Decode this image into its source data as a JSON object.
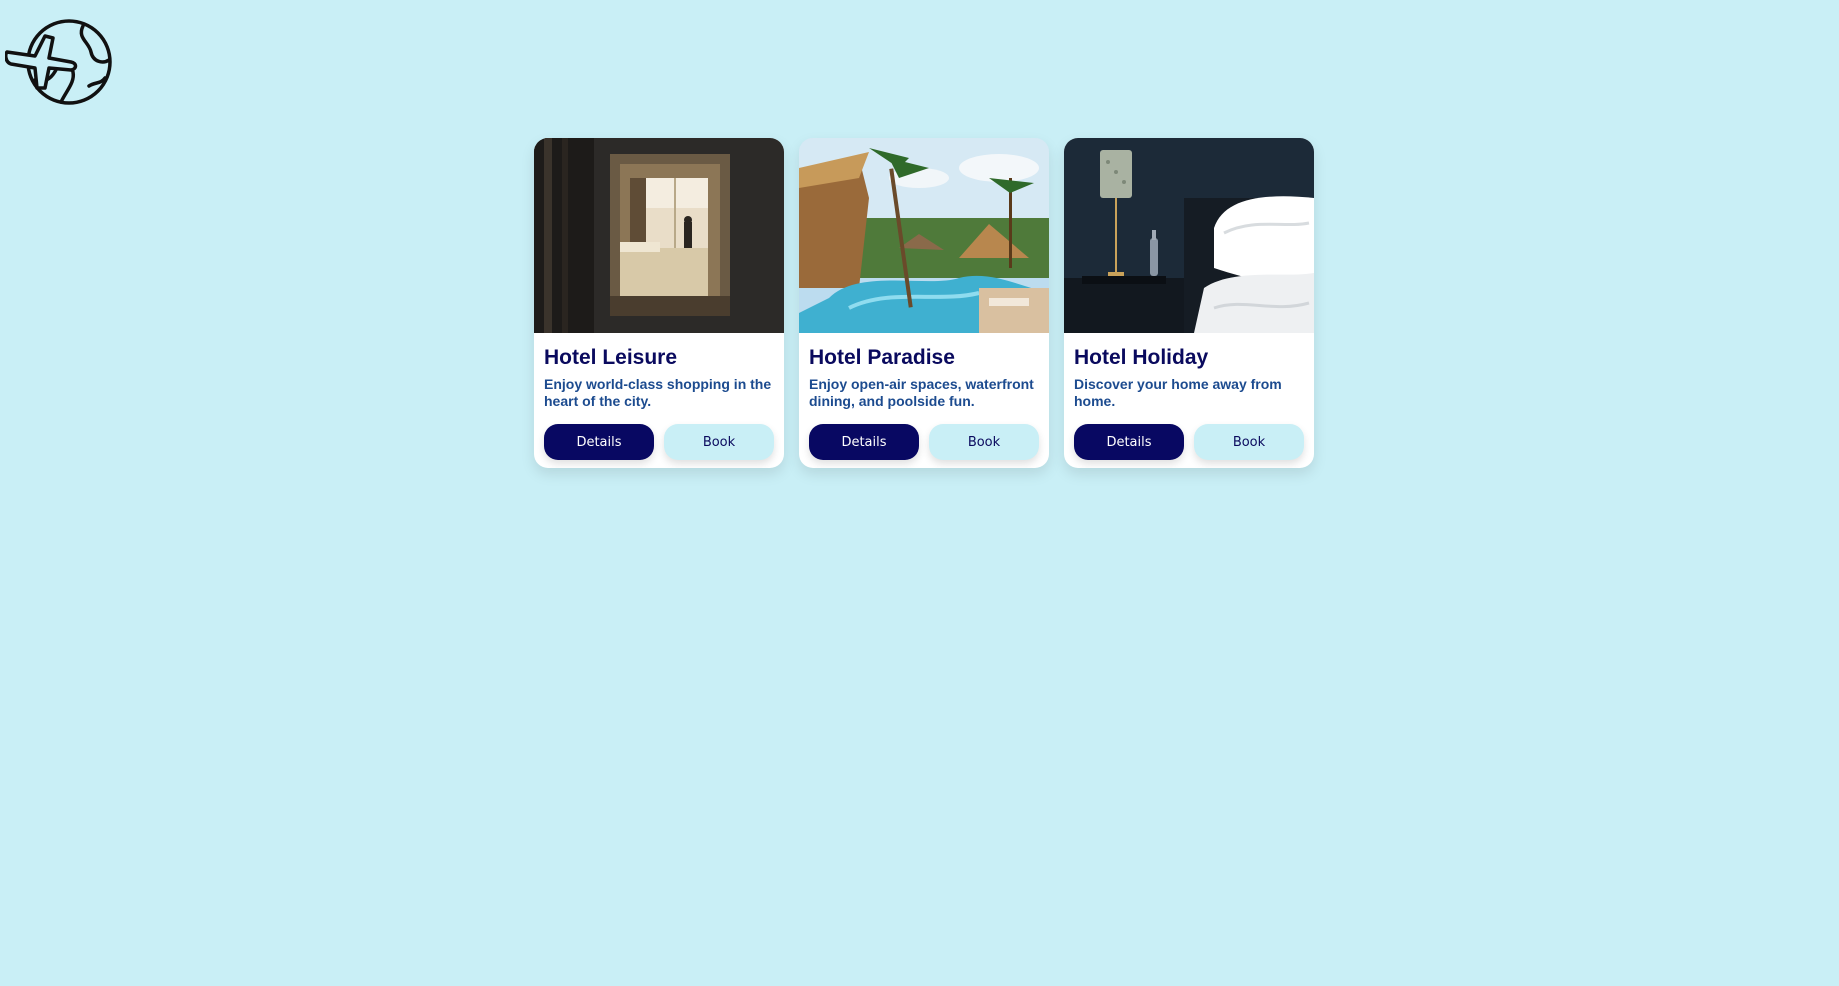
{
  "app": {
    "logo_icon": "globe-plane-icon"
  },
  "colors": {
    "background": "#c9eff6",
    "primary_button": "#080862",
    "title_text": "#0a0a5e",
    "description_text": "#1c4b8f"
  },
  "cards": [
    {
      "image_icon": "hotel-room-image",
      "title": "Hotel Leisure",
      "description": "Enjoy world-class shopping in the heart of the city.",
      "details_label": "Details",
      "book_label": "Book"
    },
    {
      "image_icon": "resort-pool-image",
      "title": "Hotel Paradise",
      "description": "Enjoy open-air spaces, waterfront dining, and poolside fun.",
      "details_label": "Details",
      "book_label": "Book"
    },
    {
      "image_icon": "bedroom-image",
      "title": "Hotel Holiday",
      "description": "Discover your home away from home.",
      "details_label": "Details",
      "book_label": "Book"
    }
  ]
}
